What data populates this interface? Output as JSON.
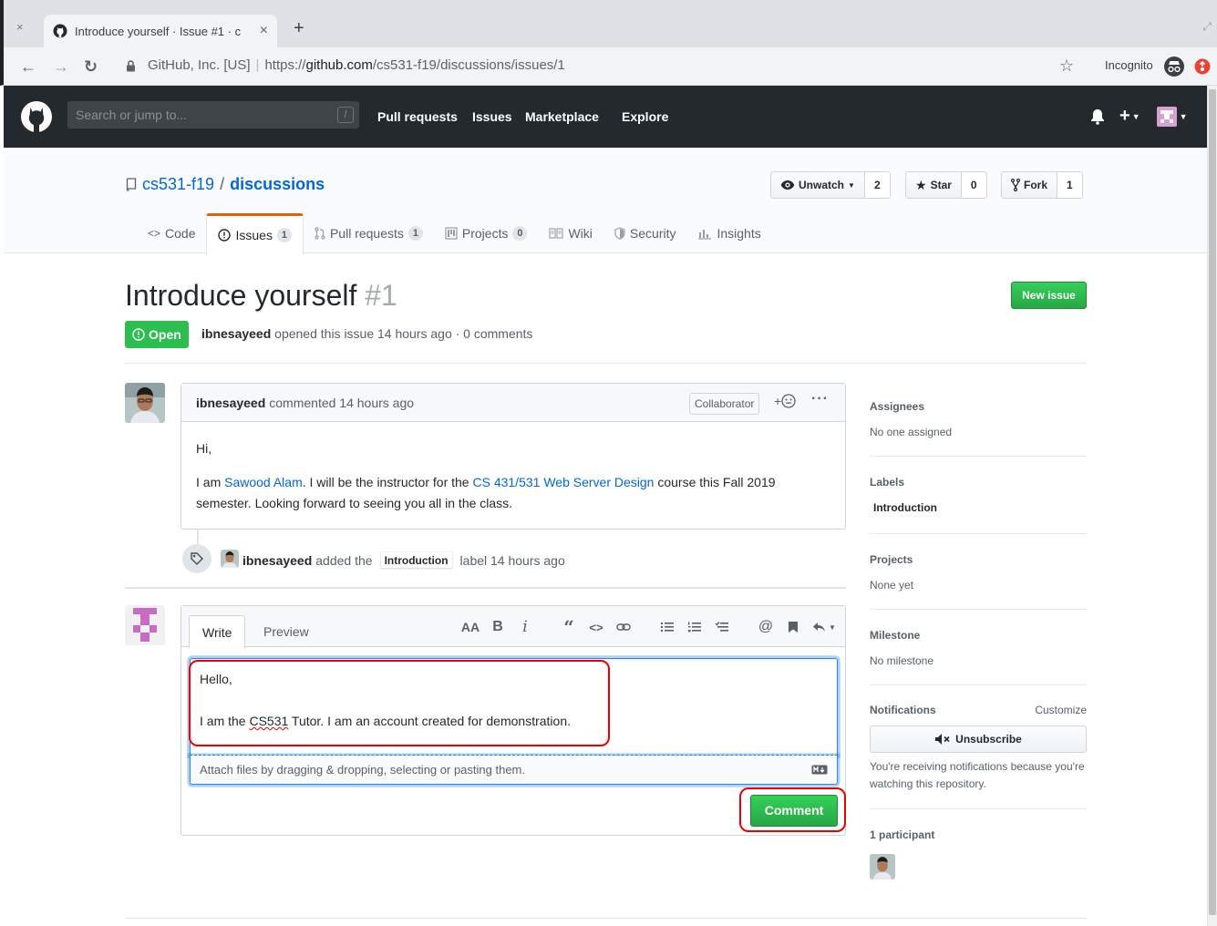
{
  "browser": {
    "tab_title": "Introduce yourself · Issue #1 · c",
    "new_tab": "+",
    "win_close": "×",
    "tab_close": "×",
    "security_label": "GitHub, Inc. [US]",
    "url_prefix": "https://",
    "url_host": "github.com",
    "url_path": "/cs531-f19/discussions/issues/1",
    "incognito_label": "Incognito"
  },
  "header": {
    "search_placeholder": "Search or jump to...",
    "search_shortcut": "/",
    "nav": [
      "Pull requests",
      "Issues",
      "Marketplace",
      "Explore"
    ],
    "plus": "+"
  },
  "repo": {
    "owner": "cs531-f19",
    "separator": "/",
    "name": "discussions",
    "watch_label": "Unwatch",
    "watch_count": "2",
    "star_label": "Star",
    "star_count": "0",
    "fork_label": "Fork",
    "fork_count": "1",
    "tabs": [
      {
        "label": "Code"
      },
      {
        "label": "Issues",
        "count": "1"
      },
      {
        "label": "Pull requests",
        "count": "1"
      },
      {
        "label": "Projects",
        "count": "0"
      },
      {
        "label": "Wiki"
      },
      {
        "label": "Security"
      },
      {
        "label": "Insights"
      }
    ]
  },
  "issue": {
    "title": "Introduce yourself",
    "number": "#1",
    "new_issue_label": "New issue",
    "state": "Open",
    "author": "ibnesayeed",
    "meta_rest": "opened this issue 14 hours ago · 0 comments"
  },
  "comment": {
    "author": "ibnesayeed",
    "action": "commented 14 hours ago",
    "badge": "Collaborator",
    "react_plus": "+",
    "more": "···",
    "greeting": "Hi,",
    "body_1": "I am ",
    "link_1": "Sawood Alam",
    "body_2": ". I will be the instructor for the ",
    "link_2": "CS 431/531 Web Server Design",
    "body_3": " course this Fall 2019 semester. Looking forward to seeing you all in the class."
  },
  "event": {
    "actor": "ibnesayeed",
    "text_1": "added the",
    "label": "Introduction",
    "text_2": "label 14 hours ago"
  },
  "new_comment": {
    "write_tab": "Write",
    "preview_tab": "Preview",
    "text_line_1": "Hello,",
    "text_line_2a": "I am the ",
    "text_line_2b": "CS531",
    "text_line_2c": " Tutor. I am an account created for demonstration.",
    "attach_hint": "Attach files by dragging & dropping, selecting or pasting them.",
    "submit_label": "Comment",
    "toolbar": [
      "header-icon",
      "bold-icon",
      "italic-icon",
      "quote-icon",
      "code-icon",
      "link-icon",
      "bulleted-list-icon",
      "numbered-list-icon",
      "task-list-icon",
      "mention-icon",
      "saved-reply-icon",
      "reply-icon"
    ]
  },
  "sidebar": {
    "assignees_title": "Assignees",
    "assignees_value": "No one assigned",
    "labels_title": "Labels",
    "labels_value": "Introduction",
    "projects_title": "Projects",
    "projects_value": "None yet",
    "milestone_title": "Milestone",
    "milestone_value": "No milestone",
    "notifications_title": "Notifications",
    "customize_label": "Customize",
    "unsubscribe_label": "Unsubscribe",
    "notifications_note": "You're receiving notifications because you're watching this repository.",
    "participants_title": "1 participant"
  },
  "colors": {
    "accent_blue": "#0366d6",
    "success_green": "#2cbe4e",
    "highlight_red": "#e00000",
    "header_dark": "#24292e"
  }
}
